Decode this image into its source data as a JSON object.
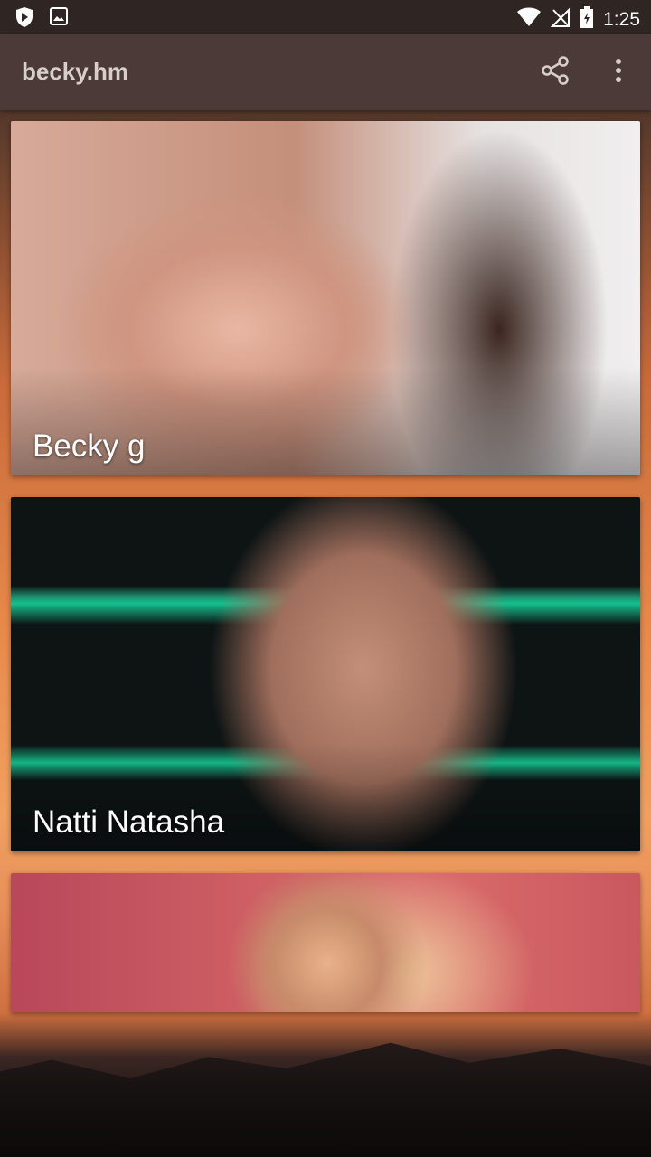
{
  "status_bar": {
    "time": "1:25",
    "left_icons": [
      "shield-icon",
      "image-icon"
    ],
    "right_icons": [
      "wifi-icon",
      "no-signal-icon",
      "battery-icon"
    ]
  },
  "app_bar": {
    "title": "becky.hm",
    "actions": [
      "share-icon",
      "more-vert-icon"
    ],
    "background": "#4b3a37"
  },
  "cards": [
    {
      "caption": "Becky g"
    },
    {
      "caption": "Natti Natasha"
    },
    {
      "caption": ""
    }
  ]
}
